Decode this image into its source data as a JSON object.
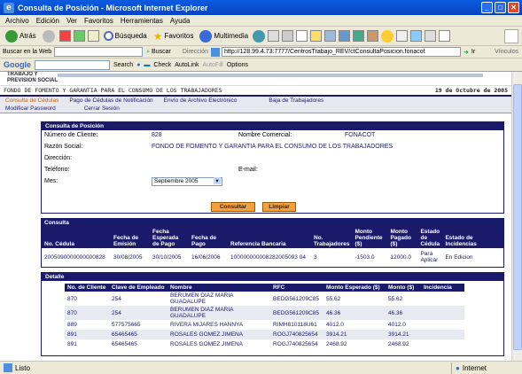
{
  "window": {
    "title": "Consulta de Posición - Microsoft Internet Explorer",
    "controls": {
      "minimize": "_",
      "maximize": "□",
      "close": "✕"
    }
  },
  "menu": [
    "Archivo",
    "Edición",
    "Ver",
    "Favoritos",
    "Herramientas",
    "Ayuda"
  ],
  "toolbar": {
    "back": "Atrás",
    "search": "Búsqueda",
    "favorites": "Favoritos",
    "multimedia": "Multimedia"
  },
  "address": {
    "search_label": "Buscar en la Web",
    "search_button": "Buscar",
    "direccion_label": "Dirección",
    "url": "http://128.99.4.73:7777/CentrosTrabajo_REV/ctConsultaPosicion.fonacot",
    "go": "Ir",
    "links": "Vínculos"
  },
  "google": {
    "brand": "Google",
    "search": "Search",
    "check": "Check",
    "autolink": "AutoLink",
    "autofill": "AutoFill",
    "options": "Options"
  },
  "page": {
    "logo_text": "TRABAJO Y\nPREVISION SOCIAL",
    "org_name": "FONDO DE FOMENTO Y GARANTIA PARA EL CONSUMO DE LOS TRABAJADORES",
    "date": "19 de Octubre de 2005",
    "nav_row1": [
      "Consulta de Cédulas",
      "Pago de Cédulas de Notificación",
      "Envío de Archivo Electrónico",
      "Baja de Trabajadores"
    ],
    "nav_row2": [
      "Modificar Password",
      "Cerrar Sesión"
    ]
  },
  "posicion": {
    "title": "Consulta de Posición",
    "numero_cliente_label": "Número de Cliente:",
    "numero_cliente": "828",
    "nombre_comercial_label": "Nombre Comercial:",
    "nombre_comercial": "FONACOT",
    "razon_social_label": "Razón Social:",
    "razon_social": "FONDO DE FOMENTO Y GARANTIA PARA EL CONSUMO DE LOS TRABAJADORES",
    "direccion_label": "Dirección:",
    "telefono_label": "Teléfono:",
    "email_label": "E-mail:",
    "mes_label": "Mes:",
    "mes_value": "Septiembre 2005",
    "consultar": "Consultar",
    "limpiar": "Limpiar"
  },
  "consulta": {
    "title": "Consulta",
    "headers": [
      "No. Cédula",
      "Fecha de Emisión",
      "Fecha Esperada de Pago",
      "Fecha de Pago",
      "Referencia Bancaria",
      "No. Trabajadores",
      "Monto Pendiente ($)",
      "Monto Pagado ($)",
      "Estado de Cédula",
      "Estado de Incidencias"
    ],
    "rows": [
      [
        "2005090000000000828",
        "30/08/2005",
        "30/10/2005",
        "16/06/2006",
        "100000000008282005093 04",
        "3",
        "-1503.0",
        "12000.0",
        "Para Aplicar",
        "En Edicion"
      ]
    ]
  },
  "detalle": {
    "title": "Detalle",
    "headers": [
      "No. de Cliente",
      "Clave de Empleado",
      "Nombre",
      "RFC",
      "Monto Esperado ($)",
      "Monto ($)",
      "Incidencia"
    ],
    "rows": [
      [
        "870",
        "254",
        "BERUMEN DIAZ MARIA GUADALUPE",
        "BEDG561209C85",
        "55.62",
        "55.62",
        ""
      ],
      [
        "870",
        "254",
        "BERUMEN DIAZ MARIA GUADALUPE",
        "BEDG561209C85",
        "46.36",
        "46.36",
        ""
      ],
      [
        "889",
        "577575665",
        "RIVERA MIJARES HANNYA",
        "RIMH810118U61",
        "4012.0",
        "4012.0",
        ""
      ],
      [
        "891",
        "65465465",
        "ROSALES GOMEZ JIMENA",
        "ROGJ740825654",
        "3914.21",
        "3914.21",
        ""
      ],
      [
        "891",
        "65465465",
        "ROSALES GOMEZ JIMENA",
        "ROGJ740825654",
        "2468.92",
        "2468.92",
        ""
      ]
    ]
  },
  "status": {
    "left": "Listo",
    "zone": "Internet"
  },
  "colors": {
    "title_blue": "#0a5ce0",
    "nav_blue": "#1a1a6a",
    "button_orange": "#f4a040"
  }
}
